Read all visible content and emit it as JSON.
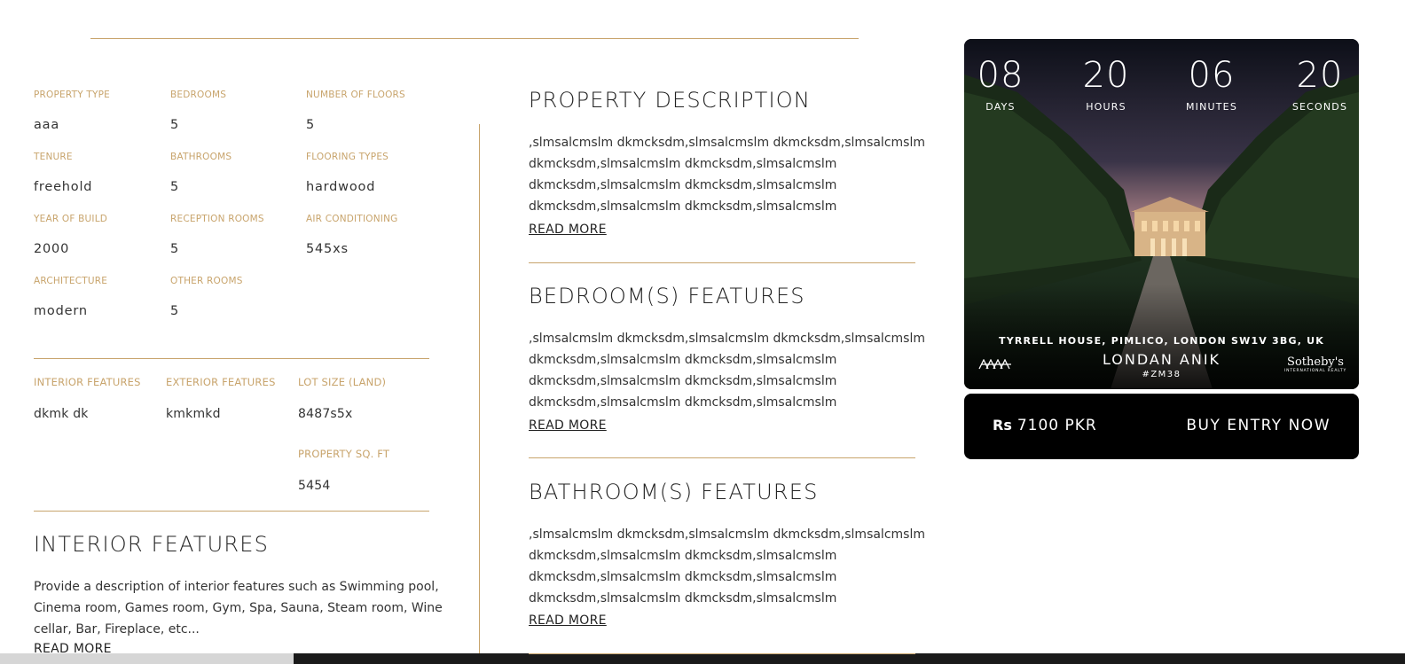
{
  "specs": [
    {
      "label": "PROPERTY TYPE",
      "value": "aaa"
    },
    {
      "label": "BEDROOMS",
      "value": "5"
    },
    {
      "label": "NUMBER OF FLOORS",
      "value": "5"
    },
    {
      "label": "TENURE",
      "value": "freehold"
    },
    {
      "label": "BATHROOMS",
      "value": "5"
    },
    {
      "label": "FLOORING TYPES",
      "value": "hardwood"
    },
    {
      "label": "YEAR OF BUILD",
      "value": "2000"
    },
    {
      "label": "RECEPTION ROOMS",
      "value": "5"
    },
    {
      "label": "AIR CONDITIONING",
      "value": "545xs"
    },
    {
      "label": "ARCHITECTURE",
      "value": "modern"
    },
    {
      "label": "OTHER ROOMS",
      "value": "5"
    }
  ],
  "features": [
    {
      "label": "INTERIOR FEATURES",
      "value": "dkmk dk"
    },
    {
      "label": "EXTERIOR FEATURES",
      "value": "kmkmkd"
    },
    {
      "label": "LOT SIZE (LAND)",
      "value": "8487s5x"
    },
    {
      "label": "PROPERTY SQ. FT",
      "value": "5454"
    }
  ],
  "interior": {
    "title": "INTERIOR FEATURES",
    "lines": [
      "Provide a description of interior features such as Swimming pool,",
      "Cinema room, Games room, Gym, Spa, Sauna, Steam room, Wine",
      "cellar, Bar, Fireplace, etc..."
    ],
    "read_more": "READ MORE"
  },
  "sections": [
    {
      "title": "PROPERTY   DESCRIPTION",
      "lines": [
        ",slmsalcmslm dkmcksdm,slmsalcmslm dkmcksdm,slmsalcmslm",
        "dkmcksdm,slmsalcmslm dkmcksdm,slmsalcmslm",
        "dkmcksdm,slmsalcmslm dkmcksdm,slmsalcmslm",
        "dkmcksdm,slmsalcmslm dkmcksdm,slmsalcmslm"
      ],
      "read_more": "READ MORE"
    },
    {
      "title": "BEDROOM(S)   FEATURES",
      "lines": [
        ",slmsalcmslm dkmcksdm,slmsalcmslm dkmcksdm,slmsalcmslm",
        "dkmcksdm,slmsalcmslm dkmcksdm,slmsalcmslm",
        "dkmcksdm,slmsalcmslm dkmcksdm,slmsalcmslm",
        "dkmcksdm,slmsalcmslm dkmcksdm,slmsalcmslm"
      ],
      "read_more": "READ MORE"
    },
    {
      "title": "BATHROOM(S)   FEATURES",
      "lines": [
        ",slmsalcmslm dkmcksdm,slmsalcmslm dkmcksdm,slmsalcmslm",
        "dkmcksdm,slmsalcmslm dkmcksdm,slmsalcmslm",
        "dkmcksdm,slmsalcmslm dkmcksdm,slmsalcmslm",
        "dkmcksdm,slmsalcmslm dkmcksdm,slmsalcmslm"
      ],
      "read_more": "READ MORE"
    }
  ],
  "countdown": [
    {
      "value": "08",
      "unit": "DAYS"
    },
    {
      "value": "20",
      "unit": "HOURS"
    },
    {
      "value": "06",
      "unit": "MINUTES"
    },
    {
      "value": "20",
      "unit": "SECONDS"
    }
  ],
  "card": {
    "address": "TYRRELL HOUSE, PIMLICO, LONDON SW1V 3BG, UK",
    "name": "LONDAN ANIK",
    "code": "#ZM38",
    "brand_right": "Sotheby's",
    "brand_right_sub": "INTERNATIONAL REALTY"
  },
  "buy": {
    "currency_symbol": "Rs",
    "price": "7100 PKR",
    "button": "BUY ENTRY NOW"
  },
  "colors": {
    "accent": "#c8a46c",
    "dark": "#000000"
  }
}
